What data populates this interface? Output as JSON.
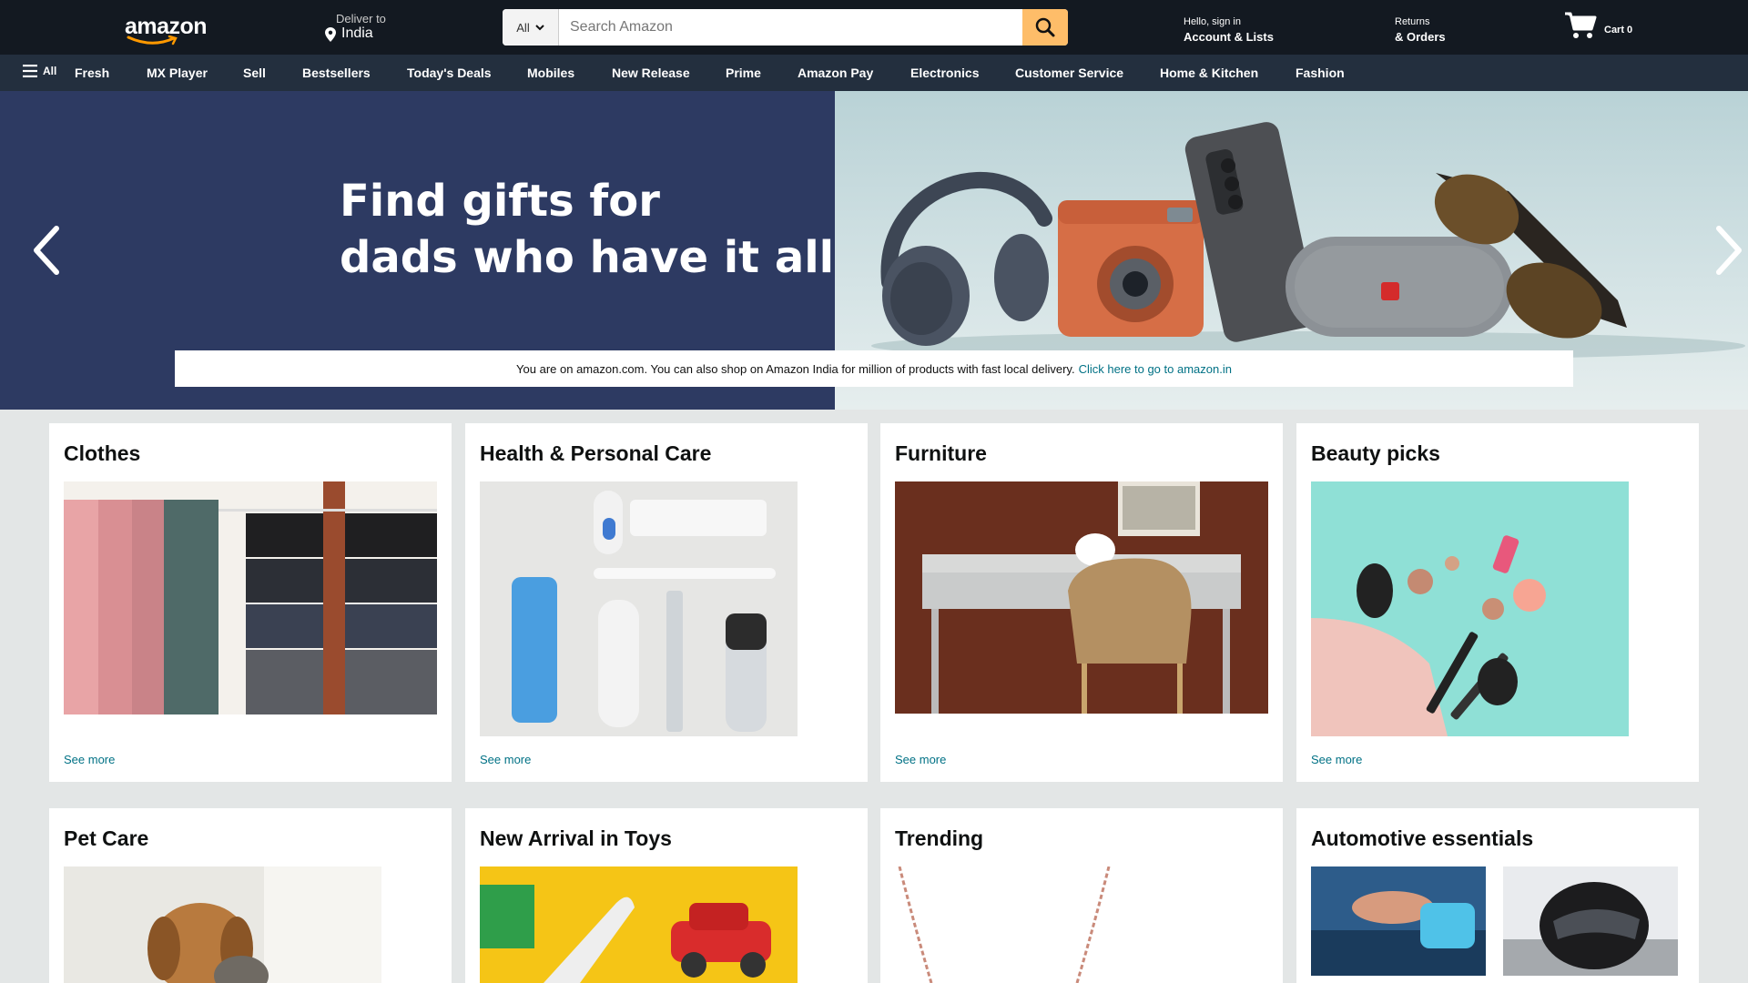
{
  "header": {
    "logo_text": "amazon",
    "deliver_label": "Deliver to",
    "deliver_location": "India",
    "search": {
      "category": "All",
      "placeholder": "Search Amazon"
    },
    "account_greeting": "Hello, sign in",
    "account_label": "Account & Lists",
    "returns_label": "Returns",
    "orders_label": "& Orders",
    "cart_label": "Cart 0"
  },
  "nav": {
    "all_label": "All",
    "items": [
      "Fresh",
      "MX Player",
      "Sell",
      "Bestsellers",
      "Today's Deals",
      "Mobiles",
      "New Release",
      "Prime",
      "Amazon Pay",
      "Electronics",
      "Customer Service",
      "Home & Kitchen",
      "Fashion"
    ]
  },
  "hero": {
    "title_line1": "Find gifts for",
    "title_line2": "dads who have it all",
    "notice_text": "You are on amazon.com. You can also shop on Amazon India for million of products with fast local delivery.",
    "notice_link": "Click here to go to amazon.in"
  },
  "cards": [
    {
      "title": "Clothes",
      "see_more": "See more"
    },
    {
      "title": "Health & Personal Care",
      "see_more": "See more"
    },
    {
      "title": "Furniture",
      "see_more": "See more"
    },
    {
      "title": "Beauty picks",
      "see_more": "See more"
    },
    {
      "title": "Pet Care"
    },
    {
      "title": "New Arrival in Toys"
    },
    {
      "title": "Trending"
    },
    {
      "title": "Automotive essentials"
    }
  ],
  "colors": {
    "header_bg": "#131921",
    "nav_bg": "#232f3e",
    "search_button": "#febd69",
    "link": "#007185",
    "hero_left": "#2d3a62",
    "page_bg": "#e3e6e6"
  },
  "icons": [
    "location-pin-icon",
    "chevron-down-icon",
    "search-icon",
    "cart-icon",
    "hamburger-menu-icon",
    "chevron-left-icon",
    "chevron-right-icon"
  ]
}
